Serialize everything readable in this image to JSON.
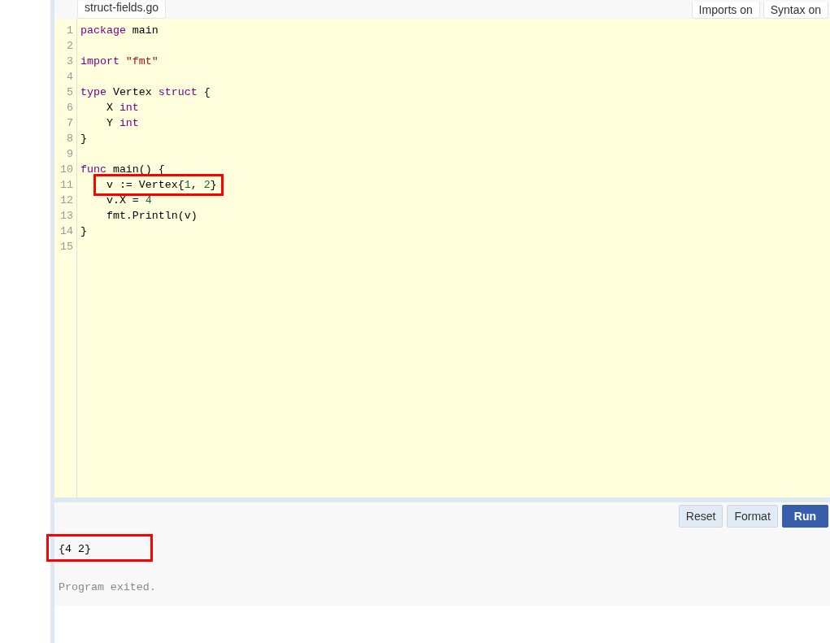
{
  "file_tab": {
    "label": "struct-fields.go",
    "selected": true
  },
  "toggles": [
    {
      "label": "Imports on"
    },
    {
      "label": "Syntax on"
    }
  ],
  "code_lines": [
    {
      "number": "1",
      "highlighted": false,
      "tokens": [
        {
          "kind": "keyword",
          "text": "package"
        },
        {
          "kind": "plain",
          "text": " main"
        }
      ]
    },
    {
      "number": "2",
      "highlighted": false
    },
    {
      "number": "3",
      "highlighted": false,
      "tokens": [
        {
          "kind": "keyword",
          "text": "import"
        },
        {
          "kind": "string",
          "text": " \"fmt\""
        }
      ]
    },
    {
      "number": "4",
      "highlighted": false
    },
    {
      "number": "5",
      "highlighted": false,
      "tokens": [
        {
          "kind": "keyword",
          "text": "type"
        },
        {
          "kind": "plain",
          "text": " Vertex "
        },
        {
          "kind": "keyword",
          "text": "struct"
        },
        {
          "kind": "plain",
          "text": " {"
        }
      ]
    },
    {
      "number": "6",
      "highlighted": false,
      "tokens": [
        {
          "kind": "plain",
          "text": "    X "
        },
        {
          "kind": "keyword",
          "text": "int"
        }
      ]
    },
    {
      "number": "7",
      "highlighted": false,
      "tokens": [
        {
          "kind": "plain",
          "text": "    Y "
        },
        {
          "kind": "keyword",
          "text": "int"
        }
      ]
    },
    {
      "number": "8",
      "highlighted": false,
      "tokens": [
        {
          "kind": "plain",
          "text": "}"
        }
      ]
    },
    {
      "number": "9",
      "highlighted": false
    },
    {
      "number": "10",
      "highlighted": false,
      "tokens": [
        {
          "kind": "keyword",
          "text": "func"
        },
        {
          "kind": "plain",
          "text": " main() {"
        }
      ]
    },
    {
      "number": "11",
      "highlighted": true,
      "tokens": [
        {
          "kind": "plain",
          "text": "    v := Vertex{"
        },
        {
          "kind": "number",
          "text": "1"
        },
        {
          "kind": "plain",
          "text": ", "
        },
        {
          "kind": "number",
          "text": "2"
        },
        {
          "kind": "plain",
          "text": "}"
        }
      ]
    },
    {
      "number": "12",
      "highlighted": false,
      "tokens": [
        {
          "kind": "plain",
          "text": "    v.X = "
        },
        {
          "kind": "number",
          "text": "4"
        }
      ]
    },
    {
      "number": "13",
      "highlighted": false,
      "tokens": [
        {
          "kind": "plain",
          "text": "    fmt.Println(v)"
        }
      ]
    },
    {
      "number": "14",
      "highlighted": false,
      "tokens": [
        {
          "kind": "plain",
          "text": "}"
        }
      ]
    },
    {
      "number": "15",
      "highlighted": false
    }
  ],
  "buttons": [
    {
      "label": "Reset",
      "kind": "secondary"
    },
    {
      "label": "Format",
      "kind": "secondary"
    },
    {
      "label": "Run",
      "kind": "primary"
    }
  ],
  "output": {
    "result": "{4 2}",
    "highlighted": true,
    "status": "Program exited."
  }
}
